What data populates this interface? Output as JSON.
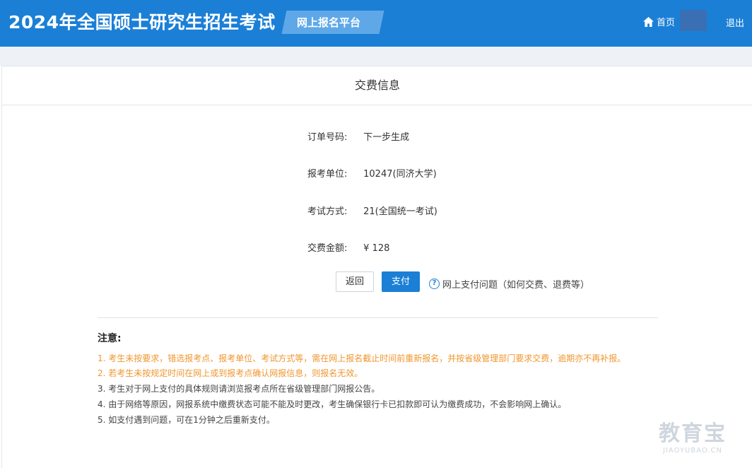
{
  "header": {
    "site_title": "2024年全国硕士研究生招生考试",
    "platform": "网上报名平台",
    "home": "首页",
    "logout": "退出"
  },
  "panel": {
    "title": "交费信息"
  },
  "order": {
    "order_no_label": "订单号码:",
    "order_no_value": "下一步生成",
    "unit_label": "报考单位:",
    "unit_value": "10247(同济大学)",
    "exam_mode_label": "考试方式:",
    "exam_mode_value": "21(全国统一考试)",
    "amount_label": "交费金额:",
    "amount_value": "¥ 128"
  },
  "actions": {
    "back": "返回",
    "pay": "支付",
    "help": "网上支付问题（如何交费、退费等）"
  },
  "notice": {
    "title": "注意:",
    "items": [
      "1. 考生未按要求，错选报考点、报考单位、考试方式等，需在网上报名截止时间前重新报名，并按省级管理部门要求交费，逾期亦不再补报。",
      "2. 若考生未按规定时间在网上或到报考点确认网报信息，则报名无效。",
      "3. 考生对于网上支付的具体规则请浏览报考点所在省级管理部门网报公告。",
      "4. 由于网络等原因，网报系统中缴费状态可能不能及时更改，考生确保银行卡已扣款即可认为缴费成功，不会影响网上确认。",
      "5. 如支付遇到问题，可在1分钟之后重新支付。"
    ]
  },
  "watermark": {
    "text": "教育宝",
    "sub": "JIAOYUBAO.CN"
  },
  "colors": {
    "brand_blue": "#1b7fd6",
    "warning_orange": "#f0962e"
  },
  "icons": {
    "home": "home-icon",
    "help": "question-circle-icon"
  }
}
